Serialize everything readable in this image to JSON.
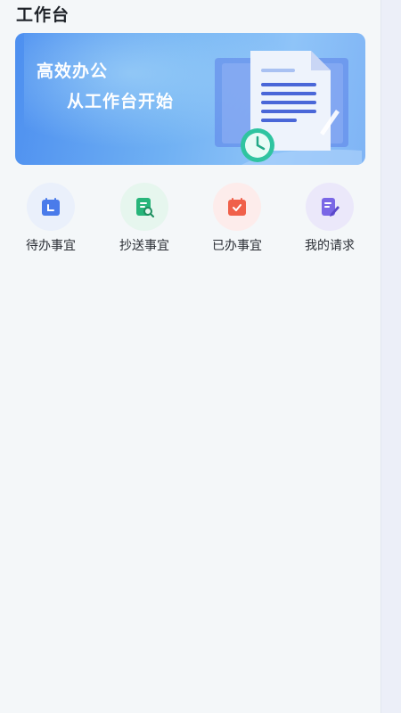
{
  "header": {
    "title": "工作台"
  },
  "banner": {
    "line1": "高效办公",
    "line2": "从工作台开始"
  },
  "quick_actions": [
    {
      "label": "待办事宜",
      "icon": "calendar-clock-icon",
      "color": "#4a7bea",
      "bg": "#eaf0fb"
    },
    {
      "label": "抄送事宜",
      "icon": "document-search-icon",
      "color": "#27b57a",
      "bg": "#e6f6ee"
    },
    {
      "label": "已办事宜",
      "icon": "calendar-check-icon",
      "color": "#f0604a",
      "bg": "#fdeceb"
    },
    {
      "label": "我的请求",
      "icon": "edit-document-icon",
      "color": "#7a67e6",
      "bg": "#ebe8fa"
    }
  ]
}
